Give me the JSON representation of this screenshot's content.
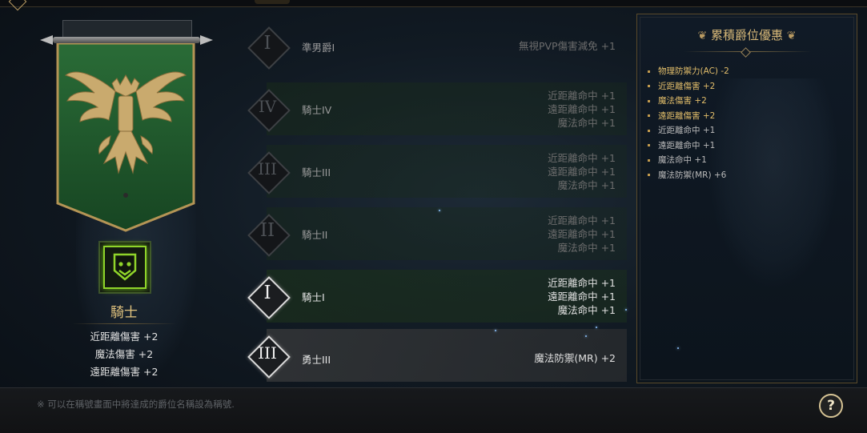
{
  "left_panel": {
    "rank_name": "騎士",
    "bonuses": [
      "近距離傷害 +2",
      "魔法傷害 +2",
      "遠距離傷害 +2"
    ],
    "banner_icon": "double-headed-eagle-emblem",
    "rank_icon": "shield-badge-icon",
    "accent_color": "#8fd42a",
    "banner_color": "#1f5a2c"
  },
  "rank_rows": [
    {
      "numeral": "I",
      "title": "準男爵I",
      "effects": [
        "無視PVP傷害減免 +1"
      ],
      "active": false
    },
    {
      "numeral": "IV",
      "title": "騎士IV",
      "effects": [
        "近距離命中 +1",
        "遠距離命中 +1",
        "魔法命中 +1"
      ],
      "active": false
    },
    {
      "numeral": "III",
      "title": "騎士III",
      "effects": [
        "近距離命中 +1",
        "遠距離命中 +1",
        "魔法命中 +1"
      ],
      "active": false
    },
    {
      "numeral": "II",
      "title": "騎士II",
      "effects": [
        "近距離命中 +1",
        "遠距離命中 +1",
        "魔法命中 +1"
      ],
      "active": false
    },
    {
      "numeral": "I",
      "title": "騎士I",
      "effects": [
        "近距離命中 +1",
        "遠距離命中 +1",
        "魔法命中 +1"
      ],
      "active": true
    },
    {
      "numeral": "III",
      "title": "勇士III",
      "effects": [
        "魔法防禦(MR) +2"
      ],
      "active": true
    }
  ],
  "cumulative": {
    "title": "累積爵位優惠",
    "items": [
      {
        "text": "物理防禦力(AC) -2",
        "gold": true
      },
      {
        "text": "近距離傷害 +2",
        "gold": true
      },
      {
        "text": "魔法傷害 +2",
        "gold": true
      },
      {
        "text": "遠距離傷害 +2",
        "gold": true
      },
      {
        "text": "近距離命中 +1",
        "gold": false
      },
      {
        "text": "遠距離命中 +1",
        "gold": false
      },
      {
        "text": "魔法命中 +1",
        "gold": false
      },
      {
        "text": "魔法防禦(MR) +6",
        "gold": false
      }
    ],
    "gold_color": "#e2bd6a"
  },
  "footer": {
    "note": "※ 可以在稱號畫面中將達成的爵位名稱設為稱號.",
    "help_label": "?"
  }
}
